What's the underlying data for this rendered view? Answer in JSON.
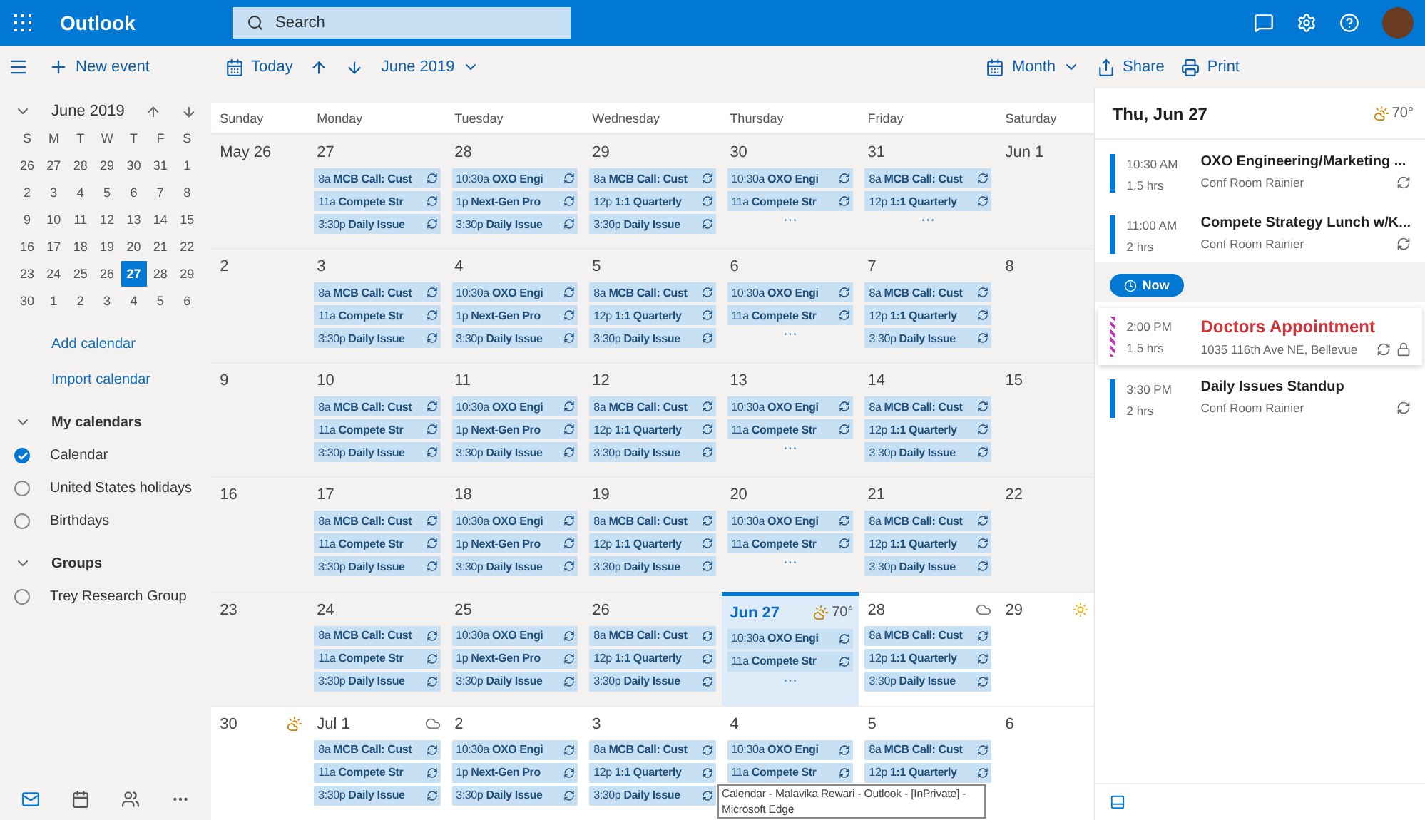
{
  "app": {
    "title": "Outlook",
    "search_placeholder": "Search"
  },
  "toolbar": {
    "new_event": "New event",
    "today": "Today",
    "period": "June 2019",
    "view": "Month",
    "share": "Share",
    "print": "Print"
  },
  "mini_calendar": {
    "title": "June 2019",
    "weekdays": [
      "S",
      "M",
      "T",
      "W",
      "T",
      "F",
      "S"
    ],
    "weeks": [
      [
        {
          "d": "26",
          "selected": false
        },
        {
          "d": "27",
          "selected": false
        },
        {
          "d": "28",
          "selected": false
        },
        {
          "d": "29",
          "selected": false
        },
        {
          "d": "30",
          "selected": false
        },
        {
          "d": "31",
          "selected": false
        },
        {
          "d": "1",
          "selected": false
        }
      ],
      [
        {
          "d": "2",
          "selected": false
        },
        {
          "d": "3",
          "selected": false
        },
        {
          "d": "4",
          "selected": false
        },
        {
          "d": "5",
          "selected": false
        },
        {
          "d": "6",
          "selected": false
        },
        {
          "d": "7",
          "selected": false
        },
        {
          "d": "8",
          "selected": false
        }
      ],
      [
        {
          "d": "9",
          "selected": false
        },
        {
          "d": "10",
          "selected": false
        },
        {
          "d": "11",
          "selected": false
        },
        {
          "d": "12",
          "selected": false
        },
        {
          "d": "13",
          "selected": false
        },
        {
          "d": "14",
          "selected": false
        },
        {
          "d": "15",
          "selected": false
        }
      ],
      [
        {
          "d": "16",
          "selected": false
        },
        {
          "d": "17",
          "selected": false
        },
        {
          "d": "18",
          "selected": false
        },
        {
          "d": "19",
          "selected": false
        },
        {
          "d": "20",
          "selected": false
        },
        {
          "d": "21",
          "selected": false
        },
        {
          "d": "22",
          "selected": false
        }
      ],
      [
        {
          "d": "23",
          "selected": false
        },
        {
          "d": "24",
          "selected": false
        },
        {
          "d": "25",
          "selected": false
        },
        {
          "d": "26",
          "selected": false
        },
        {
          "d": "27",
          "selected": true
        },
        {
          "d": "28",
          "selected": false
        },
        {
          "d": "29",
          "selected": false
        }
      ],
      [
        {
          "d": "30",
          "selected": false
        },
        {
          "d": "1",
          "selected": false
        },
        {
          "d": "2",
          "selected": false
        },
        {
          "d": "3",
          "selected": false
        },
        {
          "d": "4",
          "selected": false
        },
        {
          "d": "5",
          "selected": false
        },
        {
          "d": "6",
          "selected": false
        }
      ]
    ]
  },
  "links": [
    "Add calendar",
    "Import calendar"
  ],
  "groups": [
    {
      "title": "My calendars",
      "expanded": true,
      "items": [
        {
          "label": "Calendar",
          "checked": true
        },
        {
          "label": "United States holidays",
          "checked": false
        },
        {
          "label": "Birthdays",
          "checked": false
        }
      ]
    },
    {
      "title": "Groups",
      "expanded": true,
      "items": [
        {
          "label": "Trey Research Group",
          "checked": false
        }
      ]
    }
  ],
  "grid": {
    "weekdays": [
      "Sunday",
      "Monday",
      "Tuesday",
      "Wednesday",
      "Thursday",
      "Friday",
      "Saturday"
    ],
    "weeks": [
      [
        {
          "label": "May 26",
          "past": true
        },
        {
          "label": "27",
          "past": true,
          "events": [
            {
              "time": "8a",
              "title": "MCB Call: Cust"
            },
            {
              "time": "11a",
              "title": "Compete Str"
            },
            {
              "time": "3:30p",
              "title": "Daily Issue"
            }
          ]
        },
        {
          "label": "28",
          "past": true,
          "events": [
            {
              "time": "10:30a",
              "title": "OXO Engi"
            },
            {
              "time": "1p",
              "title": "Next-Gen Pro"
            },
            {
              "time": "3:30p",
              "title": "Daily Issue"
            }
          ]
        },
        {
          "label": "29",
          "past": true,
          "events": [
            {
              "time": "8a",
              "title": "MCB Call: Cust"
            },
            {
              "time": "12p",
              "title": "1:1 Quarterly"
            },
            {
              "time": "3:30p",
              "title": "Daily Issue"
            }
          ]
        },
        {
          "label": "30",
          "past": true,
          "more": "···",
          "events": [
            {
              "time": "10:30a",
              "title": "OXO Engi"
            },
            {
              "time": "11a",
              "title": "Compete Str"
            }
          ]
        },
        {
          "label": "31",
          "past": true,
          "more": "···",
          "events": [
            {
              "time": "8a",
              "title": "MCB Call: Cust"
            },
            {
              "time": "12p",
              "title": "1:1 Quarterly"
            }
          ]
        },
        {
          "label": "Jun 1",
          "past": true
        }
      ],
      [
        {
          "label": "2",
          "past": true
        },
        {
          "label": "3",
          "past": true,
          "events": [
            {
              "time": "8a",
              "title": "MCB Call: Cust"
            },
            {
              "time": "11a",
              "title": "Compete Str"
            },
            {
              "time": "3:30p",
              "title": "Daily Issue"
            }
          ]
        },
        {
          "label": "4",
          "past": true,
          "events": [
            {
              "time": "10:30a",
              "title": "OXO Engi"
            },
            {
              "time": "1p",
              "title": "Next-Gen Pro"
            },
            {
              "time": "3:30p",
              "title": "Daily Issue"
            }
          ]
        },
        {
          "label": "5",
          "past": true,
          "events": [
            {
              "time": "8a",
              "title": "MCB Call: Cust"
            },
            {
              "time": "12p",
              "title": "1:1 Quarterly"
            },
            {
              "time": "3:30p",
              "title": "Daily Issue"
            }
          ]
        },
        {
          "label": "6",
          "past": true,
          "more": "···",
          "events": [
            {
              "time": "10:30a",
              "title": "OXO Engi"
            },
            {
              "time": "11a",
              "title": "Compete Str"
            }
          ]
        },
        {
          "label": "7",
          "past": true,
          "events": [
            {
              "time": "8a",
              "title": "MCB Call: Cust"
            },
            {
              "time": "12p",
              "title": "1:1 Quarterly"
            },
            {
              "time": "3:30p",
              "title": "Daily Issue"
            }
          ]
        },
        {
          "label": "8",
          "past": true
        }
      ],
      [
        {
          "label": "9",
          "past": true
        },
        {
          "label": "10",
          "past": true,
          "events": [
            {
              "time": "8a",
              "title": "MCB Call: Cust"
            },
            {
              "time": "11a",
              "title": "Compete Str"
            },
            {
              "time": "3:30p",
              "title": "Daily Issue"
            }
          ]
        },
        {
          "label": "11",
          "past": true,
          "events": [
            {
              "time": "10:30a",
              "title": "OXO Engi"
            },
            {
              "time": "1p",
              "title": "Next-Gen Pro"
            },
            {
              "time": "3:30p",
              "title": "Daily Issue"
            }
          ]
        },
        {
          "label": "12",
          "past": true,
          "events": [
            {
              "time": "8a",
              "title": "MCB Call: Cust"
            },
            {
              "time": "12p",
              "title": "1:1 Quarterly"
            },
            {
              "time": "3:30p",
              "title": "Daily Issue"
            }
          ]
        },
        {
          "label": "13",
          "past": true,
          "more": "···",
          "events": [
            {
              "time": "10:30a",
              "title": "OXO Engi"
            },
            {
              "time": "11a",
              "title": "Compete Str"
            }
          ]
        },
        {
          "label": "14",
          "past": true,
          "events": [
            {
              "time": "8a",
              "title": "MCB Call: Cust"
            },
            {
              "time": "12p",
              "title": "1:1 Quarterly"
            },
            {
              "time": "3:30p",
              "title": "Daily Issue"
            }
          ]
        },
        {
          "label": "15",
          "past": true
        }
      ],
      [
        {
          "label": "16",
          "past": true
        },
        {
          "label": "17",
          "past": true,
          "events": [
            {
              "time": "8a",
              "title": "MCB Call: Cust"
            },
            {
              "time": "11a",
              "title": "Compete Str"
            },
            {
              "time": "3:30p",
              "title": "Daily Issue"
            }
          ]
        },
        {
          "label": "18",
          "past": true,
          "events": [
            {
              "time": "10:30a",
              "title": "OXO Engi"
            },
            {
              "time": "1p",
              "title": "Next-Gen Pro"
            },
            {
              "time": "3:30p",
              "title": "Daily Issue"
            }
          ]
        },
        {
          "label": "19",
          "past": true,
          "events": [
            {
              "time": "8a",
              "title": "MCB Call: Cust"
            },
            {
              "time": "12p",
              "title": "1:1 Quarterly"
            },
            {
              "time": "3:30p",
              "title": "Daily Issue"
            }
          ]
        },
        {
          "label": "20",
          "past": true,
          "more": "···",
          "events": [
            {
              "time": "10:30a",
              "title": "OXO Engi"
            },
            {
              "time": "11a",
              "title": "Compete Str"
            }
          ]
        },
        {
          "label": "21",
          "past": true,
          "events": [
            {
              "time": "8a",
              "title": "MCB Call: Cust"
            },
            {
              "time": "12p",
              "title": "1:1 Quarterly"
            },
            {
              "time": "3:30p",
              "title": "Daily Issue"
            }
          ]
        },
        {
          "label": "22",
          "past": true
        }
      ],
      [
        {
          "label": "23",
          "past": true
        },
        {
          "label": "24",
          "past": true,
          "events": [
            {
              "time": "8a",
              "title": "MCB Call: Cust"
            },
            {
              "time": "11a",
              "title": "Compete Str"
            },
            {
              "time": "3:30p",
              "title": "Daily Issue"
            }
          ]
        },
        {
          "label": "25",
          "past": true,
          "events": [
            {
              "time": "10:30a",
              "title": "OXO Engi"
            },
            {
              "time": "1p",
              "title": "Next-Gen Pro"
            },
            {
              "time": "3:30p",
              "title": "Daily Issue"
            }
          ]
        },
        {
          "label": "26",
          "past": true,
          "events": [
            {
              "time": "8a",
              "title": "MCB Call: Cust"
            },
            {
              "time": "12p",
              "title": "1:1 Quarterly"
            },
            {
              "time": "3:30p",
              "title": "Daily Issue"
            }
          ]
        },
        {
          "label": "Jun 27",
          "past": false,
          "today": true,
          "weather": {
            "kind": "partly",
            "temp": "70°"
          },
          "more": "···",
          "events": [
            {
              "time": "10:30a",
              "title": "OXO Engi"
            },
            {
              "time": "11a",
              "title": "Compete Str"
            }
          ]
        },
        {
          "label": "28",
          "past": false,
          "weather": {
            "kind": "cloud"
          },
          "events": [
            {
              "time": "8a",
              "title": "MCB Call: Cust"
            },
            {
              "time": "12p",
              "title": "1:1 Quarterly"
            },
            {
              "time": "3:30p",
              "title": "Daily Issue"
            }
          ]
        },
        {
          "label": "29",
          "past": false,
          "weather": {
            "kind": "sun"
          }
        }
      ],
      [
        {
          "label": "30",
          "past": false,
          "weather": {
            "kind": "partly"
          }
        },
        {
          "label": "Jul 1",
          "past": false,
          "weather": {
            "kind": "cloud"
          },
          "events": [
            {
              "time": "8a",
              "title": "MCB Call: Cust"
            },
            {
              "time": "11a",
              "title": "Compete Str"
            },
            {
              "time": "3:30p",
              "title": "Daily Issue"
            }
          ]
        },
        {
          "label": "2",
          "past": false,
          "events": [
            {
              "time": "10:30a",
              "title": "OXO Engi"
            },
            {
              "time": "1p",
              "title": "Next-Gen Pro"
            },
            {
              "time": "3:30p",
              "title": "Daily Issue"
            }
          ]
        },
        {
          "label": "3",
          "past": false,
          "events": [
            {
              "time": "8a",
              "title": "MCB Call: Cust"
            },
            {
              "time": "12p",
              "title": "1:1 Quarterly"
            },
            {
              "time": "3:30p",
              "title": "Daily Issue"
            }
          ]
        },
        {
          "label": "4",
          "past": false,
          "events": [
            {
              "time": "10:30a",
              "title": "OXO Engi"
            },
            {
              "time": "11a",
              "title": "Compete Str"
            }
          ]
        },
        {
          "label": "5",
          "past": false,
          "events": [
            {
              "time": "8a",
              "title": "MCB Call: Cust"
            },
            {
              "time": "12p",
              "title": "1:1 Quarterly"
            }
          ]
        },
        {
          "label": "6",
          "past": false
        }
      ]
    ]
  },
  "agenda": {
    "title": "Thu, Jun 27",
    "temp": "70°",
    "now": "Now",
    "items": [
      {
        "kind": "event",
        "time": "10:30 AM",
        "duration": "1.5 hrs",
        "title": "OXO Engineering/Marketing ...",
        "location": "Conf Room Rainier",
        "private": false
      },
      {
        "kind": "event",
        "time": "11:00 AM",
        "duration": "2 hrs",
        "title": "Compete Strategy Lunch w/K...",
        "location": "Conf Room Rainier",
        "private": false
      },
      {
        "kind": "now"
      },
      {
        "kind": "highlight",
        "time": "2:00 PM",
        "duration": "1.5 hrs",
        "title": "Doctors Appointment",
        "location": "1035 116th Ave NE, Bellevue",
        "private": true
      },
      {
        "kind": "event",
        "time": "3:30 PM",
        "duration": "2 hrs",
        "title": "Daily Issues Standup",
        "location": "Conf Room Rainier",
        "private": false
      }
    ]
  },
  "tooltip": [
    "Calendar - Malavika Rewari - Outlook - [InPrivate] -",
    "Microsoft Edge"
  ]
}
